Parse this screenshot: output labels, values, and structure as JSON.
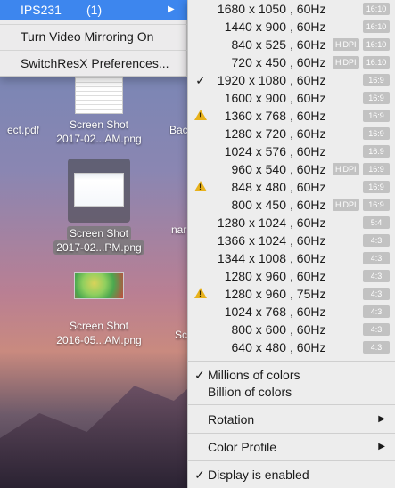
{
  "left_menu": {
    "display_name": "IPS231",
    "display_count": "(1)",
    "mirroring": "Turn Video Mirroring On",
    "preferences": "SwitchResX Preferences..."
  },
  "desktop_files": [
    {
      "label": "ect.pdf"
    },
    {
      "label_line1": "Screen Shot",
      "label_line2": "2017-02...AM.png"
    },
    {
      "label_line1": "Screen Shot",
      "label_line2": "2017-02...PM.png"
    },
    {
      "label_line1": "Screen Shot",
      "label_line2": "2016-05...AM.png"
    },
    {
      "label": "Bac"
    },
    {
      "label": "nar"
    },
    {
      "label": "Sc"
    }
  ],
  "resolutions": [
    {
      "res": "1680 x 1050",
      "rate": "60Hz",
      "hidpi": "",
      "ratio": "16:10",
      "checked": false,
      "warn": false
    },
    {
      "res": "1440 x 900",
      "rate": "60Hz",
      "hidpi": "",
      "ratio": "16:10",
      "checked": false,
      "warn": false
    },
    {
      "res": "840 x 525",
      "rate": "60Hz",
      "hidpi": "HiDPI",
      "ratio": "16:10",
      "checked": false,
      "warn": false
    },
    {
      "res": "720 x 450",
      "rate": "60Hz",
      "hidpi": "HiDPI",
      "ratio": "16:10",
      "checked": false,
      "warn": false
    },
    {
      "res": "1920 x 1080",
      "rate": "60Hz",
      "hidpi": "",
      "ratio": "16:9",
      "checked": true,
      "warn": false
    },
    {
      "res": "1600 x 900",
      "rate": "60Hz",
      "hidpi": "",
      "ratio": "16:9",
      "checked": false,
      "warn": false
    },
    {
      "res": "1360 x 768",
      "rate": "60Hz",
      "hidpi": "",
      "ratio": "16:9",
      "checked": false,
      "warn": true
    },
    {
      "res": "1280 x 720",
      "rate": "60Hz",
      "hidpi": "",
      "ratio": "16:9",
      "checked": false,
      "warn": false
    },
    {
      "res": "1024 x 576",
      "rate": "60Hz",
      "hidpi": "",
      "ratio": "16:9",
      "checked": false,
      "warn": false
    },
    {
      "res": "960 x 540",
      "rate": "60Hz",
      "hidpi": "HiDPI",
      "ratio": "16:9",
      "checked": false,
      "warn": false
    },
    {
      "res": "848 x 480",
      "rate": "60Hz",
      "hidpi": "",
      "ratio": "16:9",
      "checked": false,
      "warn": true
    },
    {
      "res": "800 x 450",
      "rate": "60Hz",
      "hidpi": "HiDPI",
      "ratio": "16:9",
      "checked": false,
      "warn": false
    },
    {
      "res": "1280 x 1024",
      "rate": "60Hz",
      "hidpi": "",
      "ratio": "5:4",
      "checked": false,
      "warn": false
    },
    {
      "res": "1366 x 1024",
      "rate": "60Hz",
      "hidpi": "",
      "ratio": "4:3",
      "checked": false,
      "warn": false
    },
    {
      "res": "1344 x 1008",
      "rate": "60Hz",
      "hidpi": "",
      "ratio": "4:3",
      "checked": false,
      "warn": false
    },
    {
      "res": "1280 x 960",
      "rate": "60Hz",
      "hidpi": "",
      "ratio": "4:3",
      "checked": false,
      "warn": false
    },
    {
      "res": "1280 x 960",
      "rate": "75Hz",
      "hidpi": "",
      "ratio": "4:3",
      "checked": false,
      "warn": true
    },
    {
      "res": "1024 x 768",
      "rate": "60Hz",
      "hidpi": "",
      "ratio": "4:3",
      "checked": false,
      "warn": false
    },
    {
      "res": "800 x 600",
      "rate": "60Hz",
      "hidpi": "",
      "ratio": "4:3",
      "checked": false,
      "warn": false
    },
    {
      "res": "640 x 480",
      "rate": "60Hz",
      "hidpi": "",
      "ratio": "4:3",
      "checked": false,
      "warn": false
    }
  ],
  "colors": {
    "millions": "Millions of colors",
    "billion": "Billion of colors",
    "millions_checked": true
  },
  "submenus": {
    "rotation": "Rotation",
    "color_profile": "Color Profile"
  },
  "display_enabled": "Display is enabled",
  "accent": "#3d86ee"
}
